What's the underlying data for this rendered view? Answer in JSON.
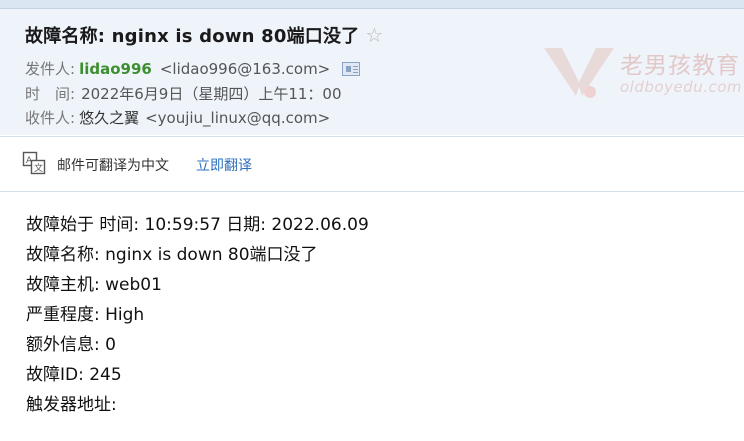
{
  "email": {
    "subject": "故障名称: nginx is down 80端口没了",
    "sender": {
      "label": "发件人:",
      "name": "lidao996",
      "email": "<lidao996@163.com>"
    },
    "time": {
      "label": "时　间:",
      "value": "2022年6月9日（星期四）上午11：00"
    },
    "recipient": {
      "label": "收件人:",
      "name": "悠久之翼",
      "email": "<youjiu_linux@qq.com>"
    }
  },
  "watermark": {
    "brand": "老男孩教育",
    "url": "oldboyedu.com"
  },
  "translate": {
    "prompt": "邮件可翻译为中文",
    "action": "立即翻译"
  },
  "body": {
    "lines": [
      "故障始于 时间: 10:59:57 日期: 2022.06.09",
      "故障名称: nginx is down 80端口没了",
      "故障主机: web01",
      "严重程度: High",
      "额外信息: 0",
      "故障ID: 245",
      "触发器地址:"
    ]
  },
  "icons": {
    "star": "star-outline-icon",
    "address_card": "contact-card-icon",
    "translate": "translate-icon"
  },
  "colors": {
    "header_bg": "#eff4fb",
    "sender_name": "#3c8f2f",
    "link": "#2f6fbf"
  }
}
